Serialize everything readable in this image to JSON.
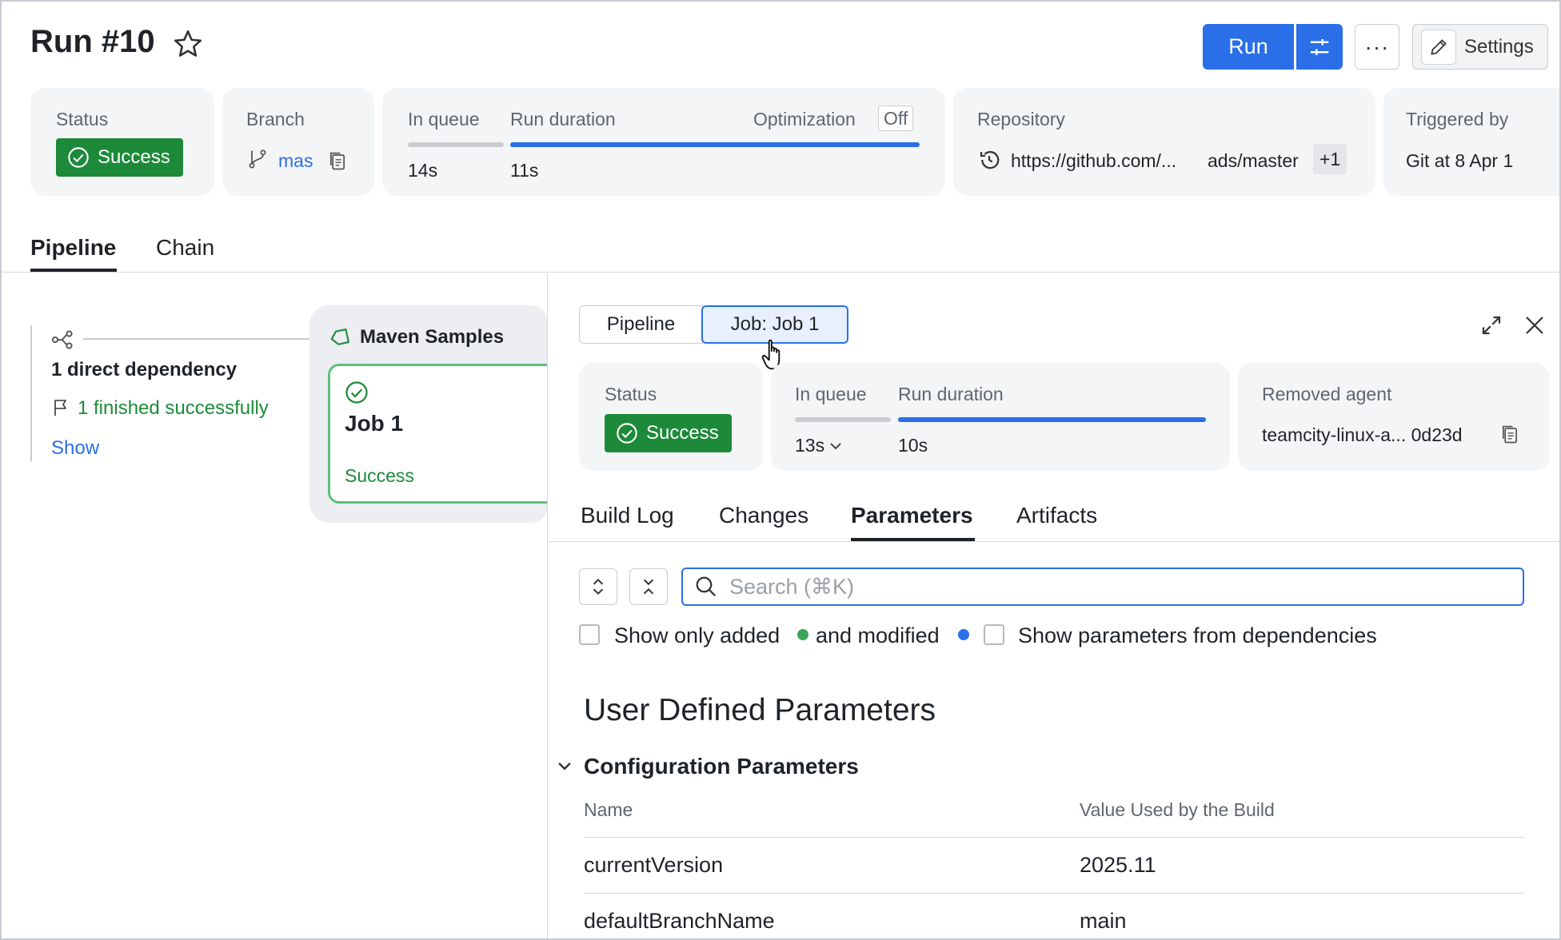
{
  "header": {
    "title": "Run #10",
    "run_label": "Run",
    "more_label": "···",
    "settings_label": "Settings"
  },
  "summary": {
    "status_label": "Status",
    "status_value": "Success",
    "branch_label": "Branch",
    "branch_value": "mas",
    "queue_label": "In queue",
    "queue_value": "14s",
    "duration_label": "Run duration",
    "duration_value": "11s",
    "optimization_label": "Optimization",
    "optimization_value": "Off",
    "repository_label": "Repository",
    "repository_url": "https://github.com/...",
    "repository_branch": "ads/master",
    "repository_extra": "+1",
    "triggered_label": "Triggered by",
    "triggered_value": "Git at 8 Apr 1"
  },
  "tabs": [
    "Pipeline",
    "Chain"
  ],
  "pipeline": {
    "dependency_count": "1 direct dependency",
    "finished": "1 finished successfully",
    "show_link": "Show",
    "group_name": "Maven Samples",
    "job_name": "Job 1",
    "job_status": "Success"
  },
  "panel": {
    "segments": [
      "Pipeline",
      "Job: Job 1"
    ],
    "status_label": "Status",
    "status_value": "Success",
    "queue_label": "In queue",
    "queue_value": "13s",
    "duration_label": "Run duration",
    "duration_value": "10s",
    "agent_label": "Removed agent",
    "agent_value": "teamcity-linux-a... 0d23d",
    "tabs": [
      "Build Log",
      "Changes",
      "Parameters",
      "Artifacts"
    ],
    "search_placeholder": "Search (⌘K)",
    "filter_added": "Show only added",
    "filter_modified": "and modified",
    "filter_dependencies": "Show parameters from dependencies",
    "section_title": "User Defined Parameters",
    "subsection_title": "Configuration Parameters",
    "col_name": "Name",
    "col_value": "Value Used by the Build",
    "rows": [
      {
        "name": "currentVersion",
        "value": "2025.11"
      },
      {
        "name": "defaultBranchName",
        "value": "main"
      }
    ]
  },
  "colors": {
    "accent": "#2a6fe8",
    "success": "#1d8a3a",
    "added_dot": "#3aa55a",
    "modified_dot": "#2a6fe8"
  }
}
